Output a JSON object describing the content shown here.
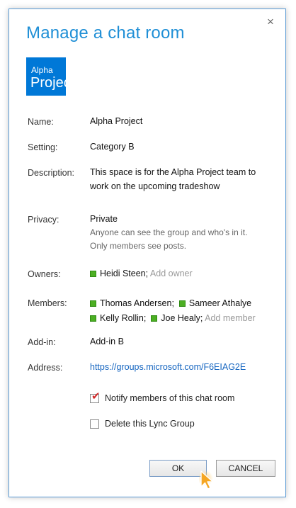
{
  "dialog": {
    "title": "Manage a chat room",
    "close_glyph": "×",
    "tile": {
      "line1": "Alpha",
      "line2": "Project",
      "color": "#0078d7"
    }
  },
  "fields": {
    "name": {
      "label": "Name:",
      "value": "Alpha Project"
    },
    "setting": {
      "label": "Setting:",
      "value": "Category B"
    },
    "description": {
      "label": "Description:",
      "value": "This space is for the Alpha Project team to work on the upcoming tradeshow"
    },
    "privacy": {
      "label": "Privacy:",
      "value": "Private",
      "note1": "Anyone can see the group and who's in it.",
      "note2": "Only members see posts."
    },
    "owners": {
      "label": "Owners:",
      "owner": "Heidi Steen;",
      "add_placeholder": "Add owner"
    },
    "members": {
      "label": "Members:",
      "list": [
        "Thomas Andersen;",
        "Sameer Athalye",
        "Kelly Rollin;",
        "Joe Healy;"
      ],
      "add_placeholder": "Add member"
    },
    "addin": {
      "label": "Add-in:",
      "value": "Add-in B"
    },
    "address": {
      "label": "Address:",
      "value": "https://groups.microsoft.com/F6EIAG2E"
    }
  },
  "options": {
    "notify": {
      "label": "Notify members of this chat room",
      "checked": true
    },
    "delete": {
      "label": "Delete this Lync Group",
      "checked": false
    }
  },
  "buttons": {
    "ok": "OK",
    "cancel": "CANCEL"
  },
  "colors": {
    "accent": "#1f8fd6",
    "presence": "#4caf23",
    "check": "#d12a2a",
    "cursor": "#f5a623"
  }
}
